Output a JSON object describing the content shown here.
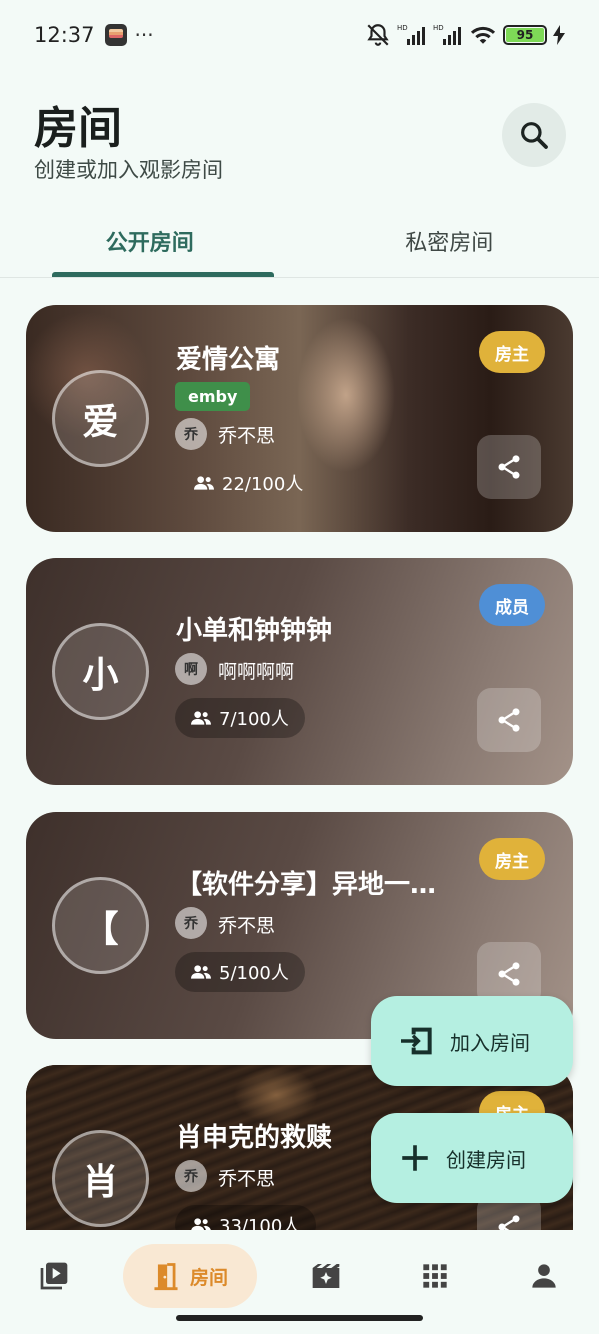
{
  "status_bar": {
    "time": "12:37",
    "dots": "···",
    "battery": "95",
    "hd1": "HD",
    "hd2": "HD"
  },
  "header": {
    "title": "房间",
    "subtitle": "创建或加入观影房间"
  },
  "tabs": [
    {
      "label": "公开房间",
      "active": true
    },
    {
      "label": "私密房间",
      "active": false
    }
  ],
  "rooms": [
    {
      "avatar": "爱",
      "title": "爱情公寓",
      "role": "房主",
      "tag": "emby",
      "owner_avatar": "乔",
      "owner": "乔不思",
      "members": "22/100人"
    },
    {
      "avatar": "小",
      "title": "小单和钟钟钟",
      "role": "成员",
      "owner_avatar": "啊",
      "owner": "啊啊啊啊",
      "members": "7/100人"
    },
    {
      "avatar": "【",
      "title": "【软件分享】异地一…",
      "role": "房主",
      "owner_avatar": "乔",
      "owner": "乔不思",
      "members": "5/100人"
    },
    {
      "avatar": "肖",
      "title": "肖申克的救赎",
      "role": "房主",
      "owner_avatar": "乔",
      "owner": "乔不思",
      "members": "33/100人"
    }
  ],
  "fabs": {
    "join_label": "加入房间",
    "create_label": "创建房间"
  },
  "nav": {
    "active_label": "房间"
  },
  "colors": {
    "accent": "#2e6b5e",
    "owner_badge": "#e0b23a",
    "member_badge": "#4f8fd6",
    "fab": "#b5efe1",
    "nav_active_bg": "#f9e8d3",
    "nav_active_text": "#dc8a2a"
  }
}
